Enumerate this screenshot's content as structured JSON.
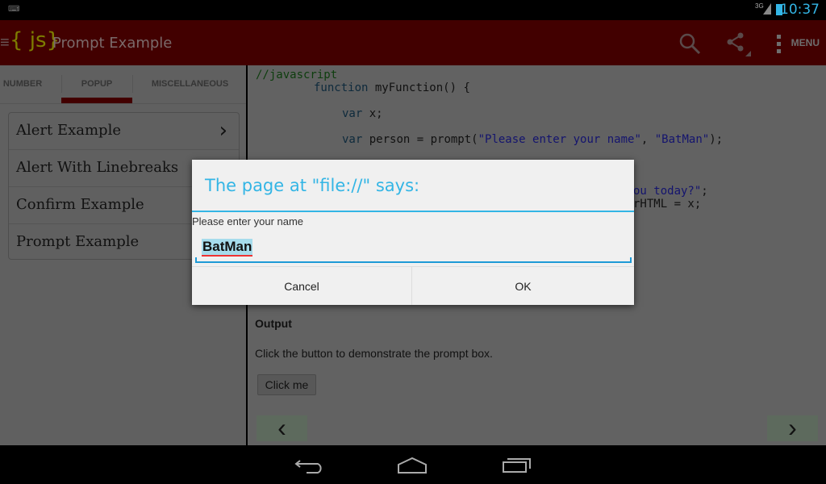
{
  "status_bar": {
    "time": "10:37",
    "network": "3G",
    "icons": [
      "keyboard-icon",
      "signal-icon",
      "battery-charging-icon"
    ]
  },
  "action_bar": {
    "title": "Prompt Example",
    "logo": "{ js}",
    "menu_label": "MENU",
    "icons": [
      "search-icon",
      "share-icon",
      "overflow-icon"
    ],
    "color": "#aa0000"
  },
  "tabs": [
    {
      "label": "NUMBER"
    },
    {
      "label": "POPUP",
      "selected": true
    },
    {
      "label": "MISCELLANEOUS"
    }
  ],
  "list": [
    {
      "label": "Alert Example"
    },
    {
      "label": "Alert With Linebreaks"
    },
    {
      "label": "Confirm Example"
    },
    {
      "label": "Prompt Example"
    }
  ],
  "code": {
    "comment": "//javascript",
    "l1_kw": "function",
    "l1": " myFunction() {",
    "l2_kw": "var",
    "l2": " x;",
    "l3_kw": "var",
    "l3a": " person = prompt(",
    "l3s1": "\"Please enter your name\"",
    "l3b": ", ",
    "l3s2": "\"BatMan\"",
    "l3c": ");",
    "frag1_str": "ou today?\"",
    "frag1": ";",
    "frag2": "rHTML = x;"
  },
  "output": {
    "heading": "Output",
    "text": "Click the button to demonstrate the prompt box.",
    "button": "Click me"
  },
  "dialog": {
    "title": "The page at \"file://\" says:",
    "message": "Please enter your name",
    "value": "BatMan",
    "cancel": "Cancel",
    "ok": "OK",
    "accent": "#33b5e5"
  },
  "nav": {
    "prev": "‹",
    "next": "›"
  }
}
